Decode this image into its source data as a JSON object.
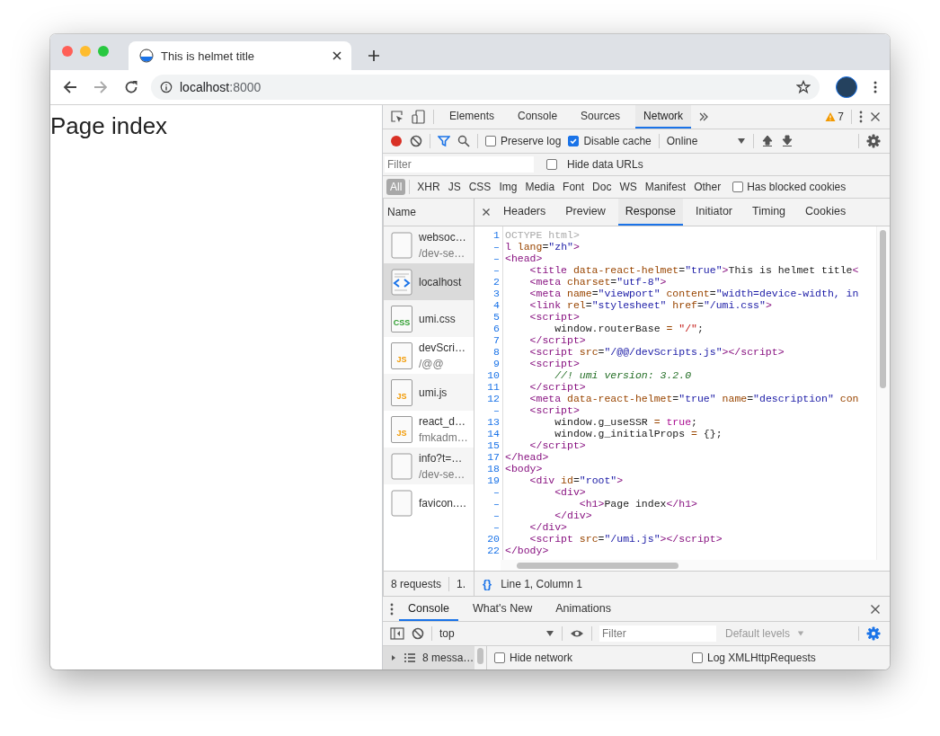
{
  "browser": {
    "tab": {
      "title": "This is helmet title"
    },
    "address": {
      "host": "localhost",
      "port": ":8000"
    }
  },
  "page": {
    "heading": "Page index"
  },
  "devtools": {
    "warnings": "7",
    "tabs": [
      {
        "label": "Elements",
        "selected": false
      },
      {
        "label": "Console",
        "selected": false
      },
      {
        "label": "Sources",
        "selected": false
      },
      {
        "label": "Network",
        "selected": true
      }
    ],
    "network": {
      "recording": true,
      "options": [
        {
          "label": "Preserve log",
          "checked": false
        },
        {
          "label": "Disable cache",
          "checked": true
        }
      ],
      "throttle": "Online",
      "filter": {
        "placeholder": "Filter"
      },
      "hide_data_urls": {
        "label": "Hide data URLs",
        "checked": false
      },
      "types": [
        {
          "label": "All",
          "selected": true
        },
        {
          "label": "XHR",
          "selected": false
        },
        {
          "label": "JS",
          "selected": false
        },
        {
          "label": "CSS",
          "selected": false
        },
        {
          "label": "Img",
          "selected": false
        },
        {
          "label": "Media",
          "selected": false
        },
        {
          "label": "Font",
          "selected": false
        },
        {
          "label": "Doc",
          "selected": false
        },
        {
          "label": "WS",
          "selected": false
        },
        {
          "label": "Manifest",
          "selected": false
        },
        {
          "label": "Other",
          "selected": false
        }
      ],
      "blocked_cookies": {
        "label": "Has blocked cookies",
        "checked": false
      },
      "name_header": "Name",
      "requests": [
        {
          "name": "websoc…",
          "path": "/dev-se…",
          "kind": "doc",
          "selected": false
        },
        {
          "name": "localhost",
          "kind": "html",
          "selected": true
        },
        {
          "name": "umi.css",
          "kind": "css",
          "icon_label": "CSS",
          "selected": false
        },
        {
          "name": "devScri…",
          "path": "/@@",
          "kind": "js",
          "icon_label": "JS",
          "selected": false
        },
        {
          "name": "umi.js",
          "kind": "js",
          "icon_label": "JS",
          "selected": false
        },
        {
          "name": "react_d…",
          "path": "fmkadm…",
          "kind": "js",
          "icon_label": "JS",
          "selected": false
        },
        {
          "name": "info?t=…",
          "path": "/dev-se…",
          "kind": "doc",
          "selected": false
        },
        {
          "name": "favicon.…",
          "kind": "doc",
          "selected": false
        }
      ],
      "summary": [
        "8 requests",
        "1."
      ],
      "detail_tabs": [
        {
          "label": "Headers",
          "selected": false
        },
        {
          "label": "Preview",
          "selected": false
        },
        {
          "label": "Response",
          "selected": true
        },
        {
          "label": "Initiator",
          "selected": false
        },
        {
          "label": "Timing",
          "selected": false
        },
        {
          "label": "Cookies",
          "selected": false
        }
      ],
      "code": [
        {
          "num": "1",
          "tokens": [
            {
              "kind": "doctype",
              "text": "OCTYPE html>"
            }
          ]
        },
        {
          "num": "–",
          "tokens": [
            {
              "kind": "tag",
              "text": "l"
            },
            {
              "kind": "attr",
              "text": " lang"
            },
            {
              "kind": "plain",
              "text": "="
            },
            {
              "kind": "str",
              "text": "\"zh\""
            },
            {
              "kind": "tag",
              "text": ">"
            }
          ]
        },
        {
          "num": "–",
          "tokens": [
            {
              "kind": "tag",
              "text": "<head>"
            }
          ]
        },
        {
          "num": "–",
          "tokens": [
            {
              "kind": "tag",
              "text": "    <title"
            },
            {
              "kind": "attr",
              "text": " data-react-helmet"
            },
            {
              "kind": "plain",
              "text": "="
            },
            {
              "kind": "str",
              "text": "\"true\""
            },
            {
              "kind": "tag",
              "text": ">"
            },
            {
              "kind": "plain",
              "text": "This is helmet title"
            },
            {
              "kind": "tag",
              "text": "<"
            }
          ]
        },
        {
          "num": "2",
          "tokens": [
            {
              "kind": "tag",
              "text": "    <meta"
            },
            {
              "kind": "attr",
              "text": " charset"
            },
            {
              "kind": "plain",
              "text": "="
            },
            {
              "kind": "str",
              "text": "\"utf-8\""
            },
            {
              "kind": "tag",
              "text": ">"
            }
          ]
        },
        {
          "num": "3",
          "tokens": [
            {
              "kind": "tag",
              "text": "    <meta"
            },
            {
              "kind": "attr",
              "text": " name"
            },
            {
              "kind": "plain",
              "text": "="
            },
            {
              "kind": "str",
              "text": "\"viewport\""
            },
            {
              "kind": "attr",
              "text": " content"
            },
            {
              "kind": "plain",
              "text": "="
            },
            {
              "kind": "str",
              "text": "\"width=device-width, in"
            }
          ]
        },
        {
          "num": "4",
          "tokens": [
            {
              "kind": "tag",
              "text": "    <link"
            },
            {
              "kind": "attr",
              "text": " rel"
            },
            {
              "kind": "plain",
              "text": "="
            },
            {
              "kind": "str",
              "text": "\"stylesheet\""
            },
            {
              "kind": "attr",
              "text": " href"
            },
            {
              "kind": "plain",
              "text": "="
            },
            {
              "kind": "str",
              "text": "\"/umi.css\""
            },
            {
              "kind": "tag",
              "text": ">"
            }
          ]
        },
        {
          "num": "5",
          "tokens": [
            {
              "kind": "tag",
              "text": "    <script>"
            }
          ]
        },
        {
          "num": "6",
          "tokens": [
            {
              "kind": "plain",
              "text": "        window.routerBase "
            },
            {
              "kind": "op",
              "text": "= "
            },
            {
              "kind": "jsstr",
              "text": "\"/\""
            },
            {
              "kind": "plain",
              "text": ";"
            }
          ]
        },
        {
          "num": "7",
          "tokens": [
            {
              "kind": "tag",
              "text": "    </script>"
            }
          ]
        },
        {
          "num": "8",
          "tokens": [
            {
              "kind": "tag",
              "text": "    <script"
            },
            {
              "kind": "attr",
              "text": " src"
            },
            {
              "kind": "plain",
              "text": "="
            },
            {
              "kind": "str",
              "text": "\"/@@/devScripts.js\""
            },
            {
              "kind": "tag",
              "text": "></script>"
            }
          ]
        },
        {
          "num": "9",
          "tokens": [
            {
              "kind": "tag",
              "text": "    <script>"
            }
          ]
        },
        {
          "num": "10",
          "tokens": [
            {
              "kind": "comment",
              "text": "        //! umi version: 3.2.0"
            }
          ]
        },
        {
          "num": "11",
          "tokens": [
            {
              "kind": "tag",
              "text": "    </script>"
            }
          ]
        },
        {
          "num": "12",
          "tokens": [
            {
              "kind": "tag",
              "text": "    <meta"
            },
            {
              "kind": "attr",
              "text": " data-react-helmet"
            },
            {
              "kind": "plain",
              "text": "="
            },
            {
              "kind": "str",
              "text": "\"true\""
            },
            {
              "kind": "attr",
              "text": " name"
            },
            {
              "kind": "plain",
              "text": "="
            },
            {
              "kind": "str",
              "text": "\"description\""
            },
            {
              "kind": "attr",
              "text": " con"
            }
          ]
        },
        {
          "num": "–",
          "tokens": [
            {
              "kind": "tag",
              "text": "    <script>"
            }
          ]
        },
        {
          "num": "13",
          "tokens": [
            {
              "kind": "plain",
              "text": "        window.g_useSSR "
            },
            {
              "kind": "op",
              "text": "= "
            },
            {
              "kind": "keyword",
              "text": "true"
            },
            {
              "kind": "plain",
              "text": ";"
            }
          ]
        },
        {
          "num": "14",
          "tokens": [
            {
              "kind": "plain",
              "text": "        window.g_initialProps "
            },
            {
              "kind": "op",
              "text": "="
            },
            {
              "kind": "plain",
              "text": " {};"
            }
          ]
        },
        {
          "num": "15",
          "tokens": [
            {
              "kind": "tag",
              "text": "    </script>"
            }
          ]
        },
        {
          "num": "17",
          "tokens": [
            {
              "kind": "tag",
              "text": "</head>"
            }
          ]
        },
        {
          "num": "18",
          "tokens": [
            {
              "kind": "tag",
              "text": "<body>"
            }
          ]
        },
        {
          "num": "19",
          "tokens": [
            {
              "kind": "tag",
              "text": "    <div"
            },
            {
              "kind": "attr",
              "text": " id"
            },
            {
              "kind": "plain",
              "text": "="
            },
            {
              "kind": "str",
              "text": "\"root\""
            },
            {
              "kind": "tag",
              "text": ">"
            }
          ]
        },
        {
          "num": "–",
          "tokens": [
            {
              "kind": "tag",
              "text": "        <div>"
            }
          ]
        },
        {
          "num": "–",
          "tokens": [
            {
              "kind": "tag",
              "text": "            <h1>"
            },
            {
              "kind": "plain",
              "text": "Page index"
            },
            {
              "kind": "tag",
              "text": "</h1>"
            }
          ]
        },
        {
          "num": "–",
          "tokens": [
            {
              "kind": "tag",
              "text": "        </div>"
            }
          ]
        },
        {
          "num": "–",
          "tokens": [
            {
              "kind": "tag",
              "text": "    </div>"
            }
          ]
        },
        {
          "num": "20",
          "tokens": [
            {
              "kind": "tag",
              "text": "    <script"
            },
            {
              "kind": "attr",
              "text": " src"
            },
            {
              "kind": "plain",
              "text": "="
            },
            {
              "kind": "str",
              "text": "\"/umi.js\""
            },
            {
              "kind": "tag",
              "text": "></script>"
            }
          ]
        },
        {
          "num": "22",
          "tokens": [
            {
              "kind": "tag",
              "text": "</body>"
            }
          ]
        }
      ],
      "pretty_print": "{}",
      "status": "Line 1, Column 1"
    },
    "drawer": {
      "tabs": [
        {
          "label": "Console",
          "selected": true
        },
        {
          "label": "What's New",
          "selected": false
        },
        {
          "label": "Animations",
          "selected": false
        }
      ],
      "context": "top",
      "filter": {
        "placeholder": "Filter"
      },
      "levels": "Default levels",
      "messages": "8 messa…",
      "options": [
        {
          "label": "Hide network",
          "checked": false
        },
        {
          "label": "Log XMLHttpRequests",
          "checked": false
        }
      ]
    }
  }
}
